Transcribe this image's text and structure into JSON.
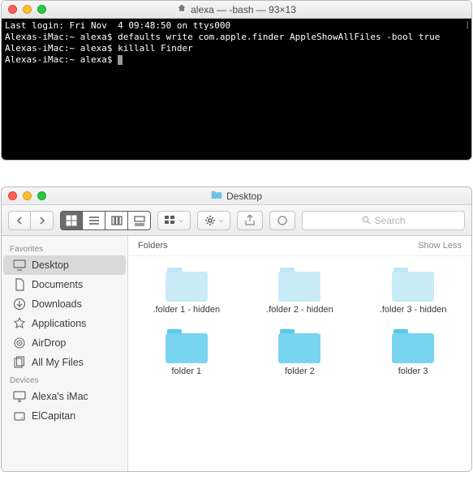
{
  "terminal": {
    "title": "alexa — -bash — 93×13",
    "lines": [
      "Last login: Fri Nov  4 09:48:50 on ttys000",
      "Alexas-iMac:~ alexa$ defaults write com.apple.finder AppleShowAllFiles -bool true",
      "Alexas-iMac:~ alexa$ killall Finder",
      "Alexas-iMac:~ alexa$ "
    ]
  },
  "finder": {
    "title": "Desktop",
    "search_placeholder": "Search",
    "content_header": "Folders",
    "show_less": "Show Less",
    "sidebar": {
      "favorites_label": "Favorites",
      "devices_label": "Devices",
      "favorites": [
        {
          "label": "Desktop",
          "icon": "desktop"
        },
        {
          "label": "Documents",
          "icon": "documents"
        },
        {
          "label": "Downloads",
          "icon": "downloads"
        },
        {
          "label": "Applications",
          "icon": "applications"
        },
        {
          "label": "AirDrop",
          "icon": "airdrop"
        },
        {
          "label": "All My Files",
          "icon": "allfiles"
        }
      ],
      "devices": [
        {
          "label": "Alexa's iMac",
          "icon": "imac"
        },
        {
          "label": "ElCapitan",
          "icon": "disk"
        }
      ]
    },
    "folders": [
      {
        "label": ".folder 1 - hidden",
        "hidden": true
      },
      {
        "label": ".folder 2 - hidden",
        "hidden": true
      },
      {
        "label": ".folder 3 - hidden",
        "hidden": true
      },
      {
        "label": "folder 1",
        "hidden": false
      },
      {
        "label": "folder 2",
        "hidden": false
      },
      {
        "label": "folder 3",
        "hidden": false
      }
    ]
  }
}
